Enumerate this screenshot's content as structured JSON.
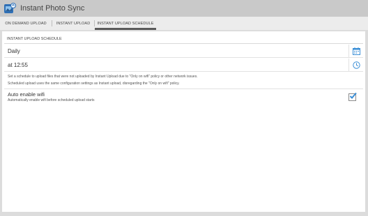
{
  "app": {
    "title": "Instant Photo Sync",
    "icon": "photo-sync-app-icon"
  },
  "tabs": [
    {
      "label": "ON DEMAND UPLOAD",
      "selected": false
    },
    {
      "label": "INSTANT UPLOAD",
      "selected": false
    },
    {
      "label": "INSTANT UPLOAD SCHEDULE",
      "selected": true
    }
  ],
  "schedule": {
    "section_title": "INSTANT UPLOAD SCHEDULE",
    "frequency": "Daily",
    "frequency_icon": "calendar-icon",
    "time": "at 12:55",
    "time_icon": "clock-icon",
    "description_line1": "Set a schedule to upload files that were not uploaded by Instant Upload due to \"Only on wifi\" policy or other network issues.",
    "description_line2": "Scheduled upload uses the same configuration settings as Instant upload, disregarding the \"Only on wifi\" policy."
  },
  "wifi": {
    "title": "Auto enable wifi",
    "subtitle": "Automatically enable wifi before scheduled upload starts",
    "checked": true
  },
  "colors": {
    "accent_blue": "#3a8ed6",
    "tab_indicator": "#5a5a5a"
  }
}
